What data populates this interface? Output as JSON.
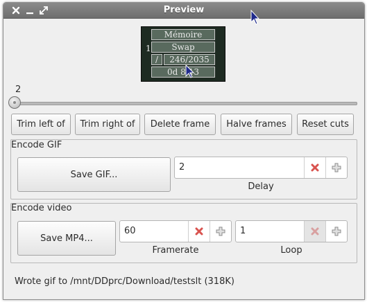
{
  "window": {
    "title": "Preview"
  },
  "preview": {
    "row_memoire": "Mémoire",
    "row_swap": "Swap",
    "row_value": "246/2035",
    "row_uptime": "0d 8:13",
    "label_1": "1",
    "label_slash": "/"
  },
  "slider": {
    "frame_label": "2",
    "position": 0
  },
  "toolbar": {
    "trim_left": "Trim left of",
    "trim_right": "Trim right of",
    "delete_frame": "Delete frame",
    "halve_frames": "Halve frames",
    "reset_cuts": "Reset cuts"
  },
  "encode_gif": {
    "group_label": "Encode GIF",
    "save_label": "Save GIF...",
    "delay_value": "2",
    "delay_label": "Delay"
  },
  "encode_video": {
    "group_label": "Encode video",
    "save_label": "Save MP4...",
    "framerate_value": "60",
    "framerate_label": "Framerate",
    "loop_value": "1",
    "loop_label": "Loop"
  },
  "status": {
    "message": "Wrote gif to /mnt/DDprc/Download/testslt (318K)"
  },
  "colors": {
    "clear_red": "#d9534f",
    "clear_disabled": "#d8a0a0",
    "titlebar": "#7a7a7a"
  },
  "icons": [
    "close-icon",
    "minimize-icon",
    "maximize-icon",
    "clear-icon",
    "plus-icon",
    "mouse-cursor-icon"
  ]
}
